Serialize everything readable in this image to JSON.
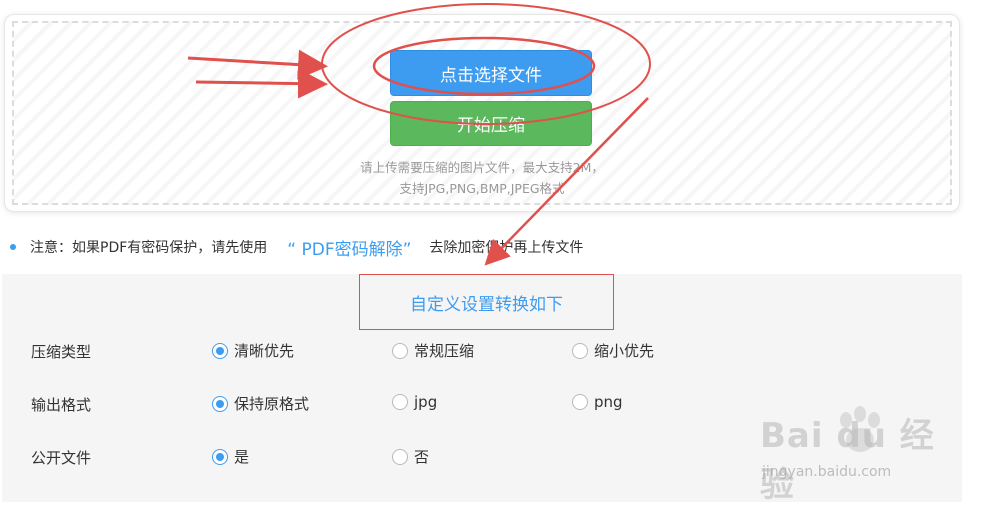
{
  "upload": {
    "select_button": "点击选择文件",
    "compress_button": "开始压缩",
    "hint_line1": "请上传需要压缩的图片文件，最大支持2M，",
    "hint_line2": "支持JPG,PNG,BMP,JPEG格式"
  },
  "notice": {
    "prefix": "注意：如果PDF有密码保护，请先使用",
    "link": "“ PDF密码解除”",
    "suffix": "去除加密保护再上传文件"
  },
  "settings": {
    "title": "自定义设置转换如下",
    "rows": [
      {
        "label": "压缩类型",
        "options": [
          {
            "label": "清晰优先",
            "checked": true
          },
          {
            "label": "常规压缩",
            "checked": false
          },
          {
            "label": "缩小优先",
            "checked": false
          }
        ]
      },
      {
        "label": "输出格式",
        "options": [
          {
            "label": "保持原格式",
            "checked": true
          },
          {
            "label": "jpg",
            "checked": false
          },
          {
            "label": "png",
            "checked": false
          }
        ]
      },
      {
        "label": "公开文件",
        "options": [
          {
            "label": "是",
            "checked": true
          },
          {
            "label": "否",
            "checked": false
          }
        ]
      }
    ]
  },
  "watermark": {
    "brand": "Bai du 经验",
    "sub": "jingyan.baidu.com"
  },
  "colors": {
    "accent": "#3e9cf0",
    "green": "#5cb85c",
    "annotation_red": "#e0504c"
  }
}
